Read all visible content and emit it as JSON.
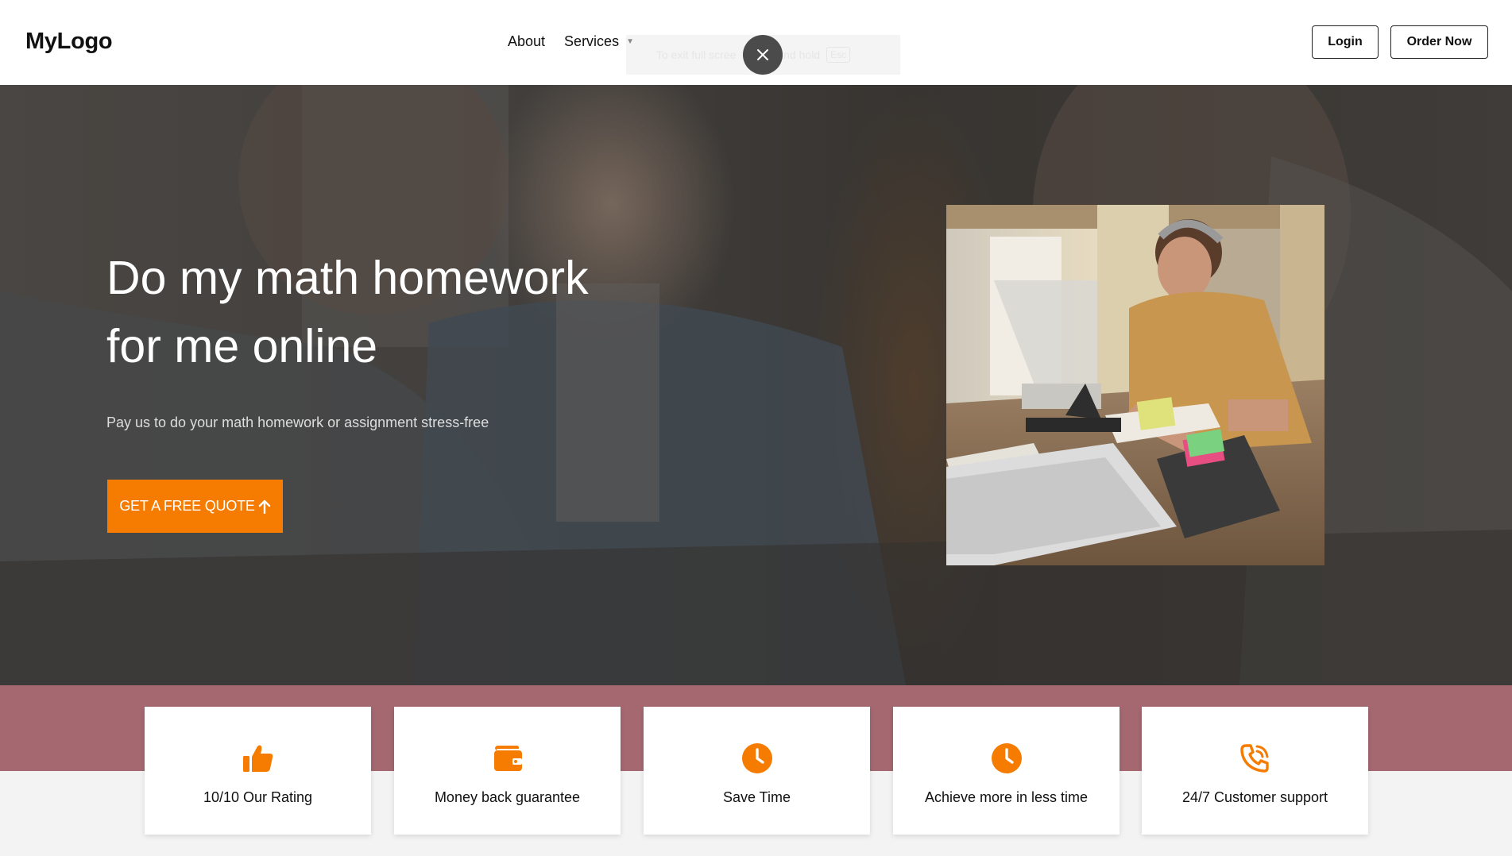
{
  "header": {
    "logo": "MyLogo",
    "nav": [
      {
        "label": "About"
      },
      {
        "label": "Services",
        "has_dropdown": true
      }
    ],
    "login_label": "Login",
    "order_label": "Order Now"
  },
  "fullscreen_toast": {
    "text_before": "To exit full scree",
    "text_after": "and hold",
    "key": "Esc"
  },
  "hero": {
    "title_line1": "Do my math homework",
    "title_line2": "for me online",
    "subtitle": "Pay us to do your math homework or assignment stress-free",
    "cta_label": "GET A FREE QUOTE"
  },
  "features": [
    {
      "label": "10/10 Our Rating",
      "icon": "thumbs-up-icon"
    },
    {
      "label": "Money back guarantee",
      "icon": "wallet-icon"
    },
    {
      "label": "Save Time",
      "icon": "clock-icon"
    },
    {
      "label": "Achieve more in less time",
      "icon": "clock-icon"
    },
    {
      "label": "24/7 Customer support",
      "icon": "phone-call-icon"
    }
  ],
  "colors": {
    "accent": "#f57c00",
    "band": "#a56870",
    "hero_overlay": "#3a3a3a"
  }
}
